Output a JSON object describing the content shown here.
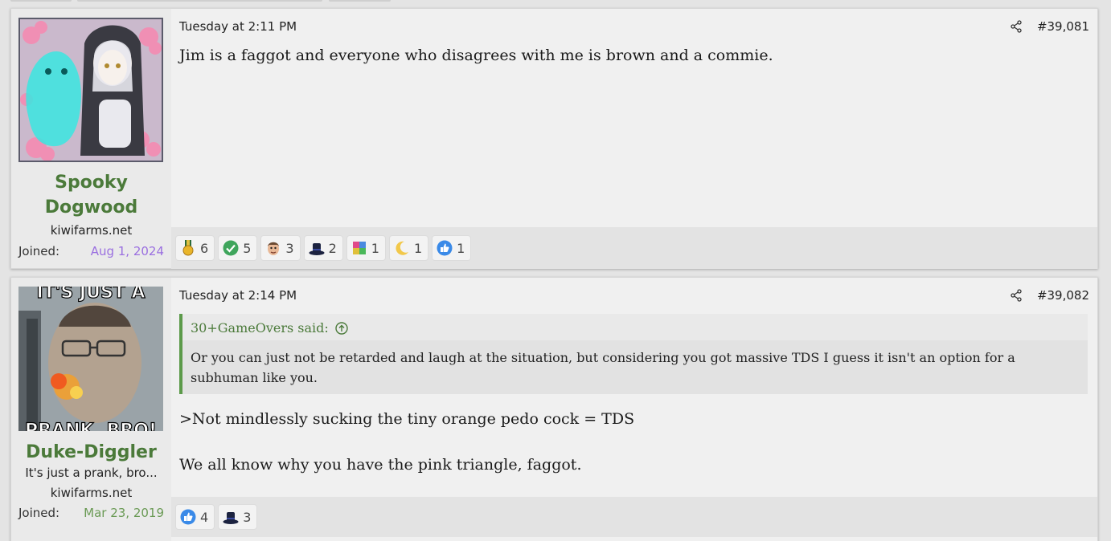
{
  "posts": [
    {
      "username": "Spooky Dogwood",
      "user_title": "",
      "site": "kiwifarms.net",
      "joined_label": "Joined:",
      "joined_date": "Aug 1, 2024",
      "date": "Tuesday at 2:11 PM",
      "post_number": "#39,081",
      "body": [
        "Jim is a faggot and everyone who disagrees with me is brown and a commie."
      ],
      "reactions": [
        {
          "icon": "medal-icon",
          "count": "6"
        },
        {
          "icon": "checkmark-icon",
          "count": "5"
        },
        {
          "icon": "face-icon",
          "count": "3"
        },
        {
          "icon": "top-hat-icon",
          "count": "2"
        },
        {
          "icon": "puzzle-icon",
          "count": "1"
        },
        {
          "icon": "crescent-moon-icon",
          "count": "1"
        },
        {
          "icon": "thumbs-up-icon",
          "count": "1"
        }
      ]
    },
    {
      "username": "Duke-Diggler",
      "user_title": "It's just a prank, bro...",
      "site": "kiwifarms.net",
      "joined_label": "Joined:",
      "joined_date": "Mar 23, 2019",
      "date": "Tuesday at 2:14 PM",
      "post_number": "#39,082",
      "avatar_caption_top": "IT'S JUST A",
      "avatar_caption_bottom": "PRANK, BRO!",
      "quote": {
        "author": "30+GameOvers said:",
        "text": "Or you can just not be retarded and laugh at the situation, but considering you got massive TDS I guess it isn't an option for a subhuman like you."
      },
      "body": [
        ">Not mindlessly sucking the tiny orange pedo cock = TDS",
        "We all know why you have the pink triangle, faggot."
      ],
      "reactions": [
        {
          "icon": "thumbs-up-icon",
          "count": "4"
        },
        {
          "icon": "top-hat-icon",
          "count": "3"
        }
      ]
    }
  ],
  "colors": {
    "username": "#4b7a3a",
    "joined_purple": "#9a6fe0",
    "joined_green": "#6a9a55",
    "quote_border": "#5c9a4a"
  }
}
